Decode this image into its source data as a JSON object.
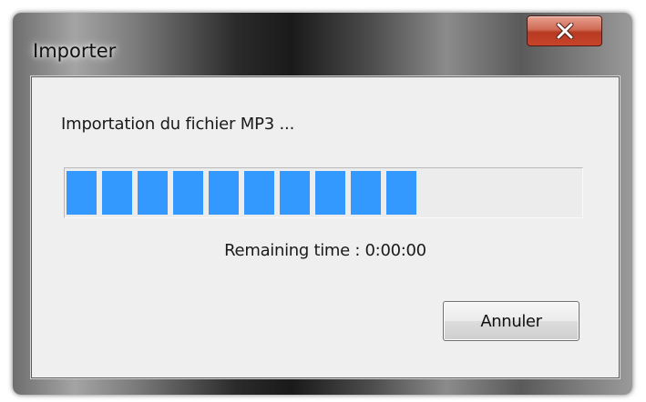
{
  "window": {
    "title": "Importer",
    "close_icon": "close-x-icon"
  },
  "dialog": {
    "message": "Importation du fichier MP3 ...",
    "remaining_time": "Remaining time : 0:00:00",
    "cancel_label": "Annuler"
  },
  "progress": {
    "value_fraction": 0.67,
    "filled_segments": 10,
    "color": "#3399ff"
  },
  "colors": {
    "close_button": "#c7432a",
    "client_background": "#efefef"
  }
}
